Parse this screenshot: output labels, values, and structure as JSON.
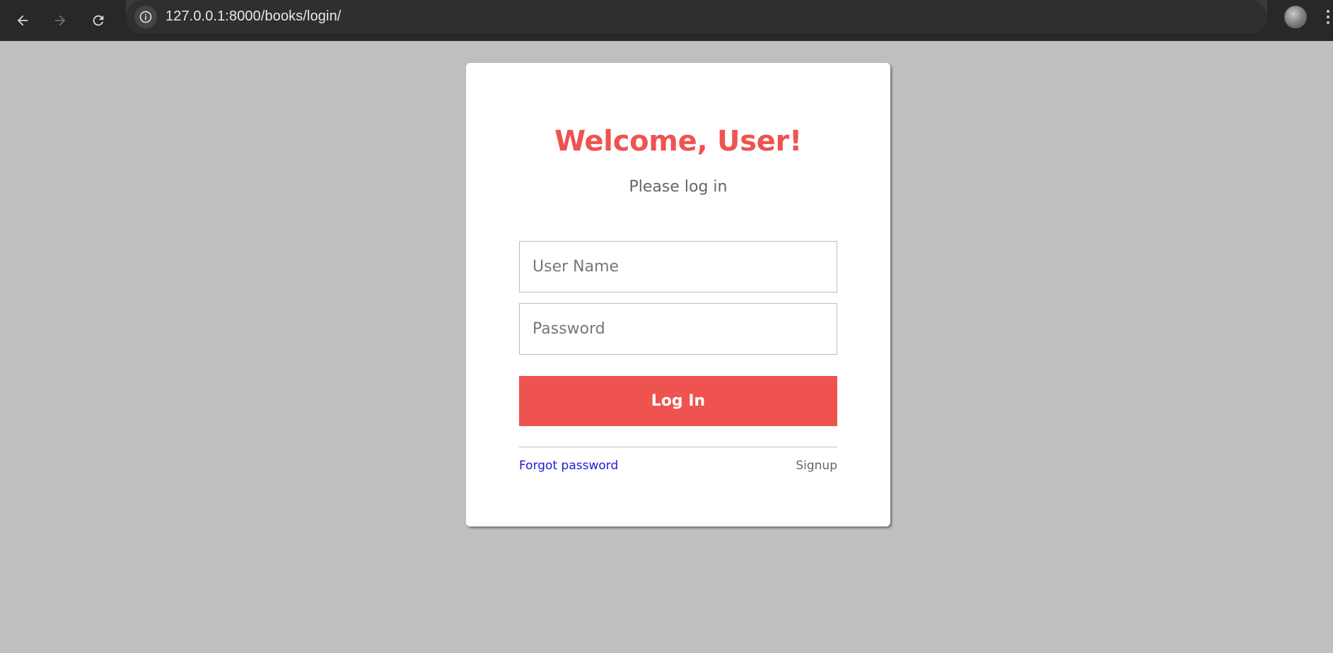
{
  "browser": {
    "url": "127.0.0.1:8000/books/login/",
    "icons": {
      "back": "arrow-left-icon",
      "forward": "arrow-right-icon",
      "reload": "reload-icon",
      "site_info": "info-icon",
      "bookmark": "star-icon",
      "profile": "avatar",
      "menu": "kebab-menu-icon"
    }
  },
  "login": {
    "title": "Welcome, User!",
    "subtitle": "Please log in",
    "username_placeholder": "User Name",
    "password_placeholder": "Password",
    "submit_label": "Log In",
    "forgot_label": "Forgot password",
    "signup_label": "Signup"
  },
  "colors": {
    "accent": "#ef5350",
    "page_background": "#bfbfbf",
    "link": "#1a1ad6",
    "browser_chrome": "#282828"
  }
}
